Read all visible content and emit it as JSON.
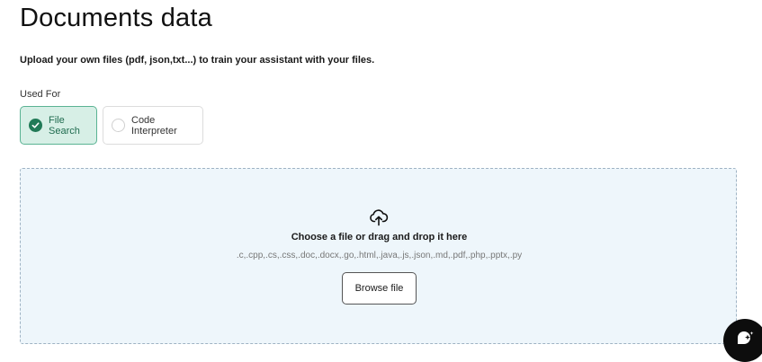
{
  "page": {
    "title": "Documents data",
    "subtitle": "Upload your own files (pdf, json,txt...) to train your assistant with your files."
  },
  "used_for": {
    "label": "Used For",
    "options": [
      {
        "label": "File Search",
        "selected": true,
        "icon": "check-circle-icon"
      },
      {
        "label": "Code Interpreter",
        "selected": false,
        "icon": "radio-circle-icon"
      }
    ]
  },
  "dropzone": {
    "icon": "cloud-upload-icon",
    "title": "Choose a file or drag and drop it here",
    "accepted_types": ".c,.cpp,.cs,.css,.doc,.docx,.go,.html,.java,.js,.json,.md,.pdf,.php,.pptx,.py",
    "browse_label": "Browse file"
  },
  "chat_widget": {
    "icon": "chat-bubble-sparkle-icon"
  },
  "colors": {
    "selected_bg": "#d7efe6",
    "selected_border": "#5ab393",
    "selected_text": "#1f6b4f",
    "dropzone_bg": "#eef6fb",
    "fab_bg": "#0d0d0d"
  }
}
